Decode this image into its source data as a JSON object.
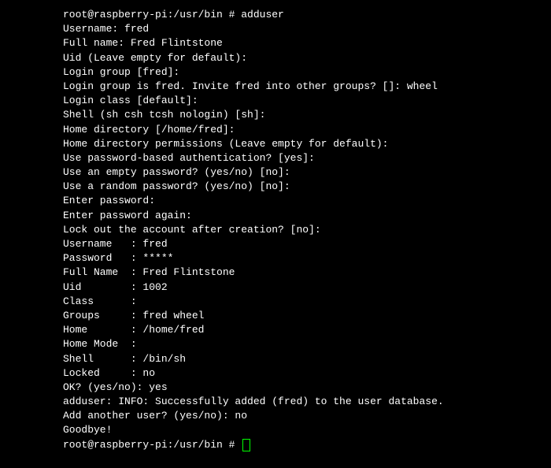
{
  "lines": {
    "l0": "root@raspberry-pi:/usr/bin # adduser",
    "l1": "Username: fred",
    "l2": "Full name: Fred Flintstone",
    "l3": "Uid (Leave empty for default):",
    "l4": "Login group [fred]:",
    "l5": "Login group is fred. Invite fred into other groups? []: wheel",
    "l6": "Login class [default]:",
    "l7": "Shell (sh csh tcsh nologin) [sh]:",
    "l8": "Home directory [/home/fred]:",
    "l9": "Home directory permissions (Leave empty for default):",
    "l10": "Use password-based authentication? [yes]:",
    "l11": "Use an empty password? (yes/no) [no]:",
    "l12": "Use a random password? (yes/no) [no]:",
    "l13": "Enter password:",
    "l14": "Enter password again:",
    "l15": "Lock out the account after creation? [no]:",
    "l16": "Username   : fred",
    "l17": "Password   : *****",
    "l18": "Full Name  : Fred Flintstone",
    "l19": "Uid        : 1002",
    "l20": "Class      :",
    "l21": "Groups     : fred wheel",
    "l22": "Home       : /home/fred",
    "l23": "Home Mode  :",
    "l24": "Shell      : /bin/sh",
    "l25": "Locked     : no",
    "l26": "OK? (yes/no): yes",
    "l27": "adduser: INFO: Successfully added (fred) to the user database.",
    "l28": "Add another user? (yes/no): no",
    "l29": "Goodbye!",
    "l30": "root@raspberry-pi:/usr/bin # "
  }
}
